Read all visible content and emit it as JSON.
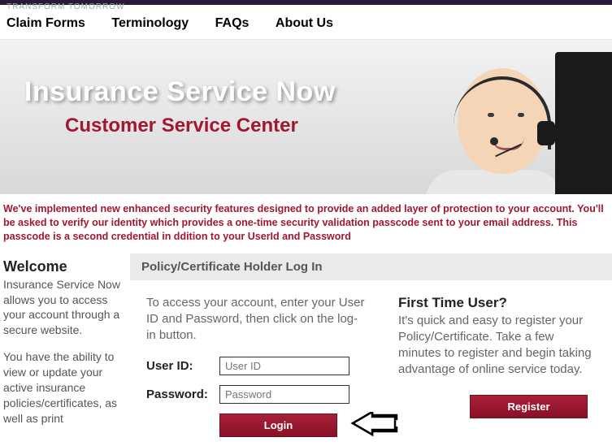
{
  "tagline": "TRANSFORM TOMORROW",
  "nav": {
    "claim_forms": "Claim Forms",
    "terminology": "Terminology",
    "faqs": "FAQs",
    "about_us": "About Us"
  },
  "hero": {
    "title": "Insurance Service Now",
    "subtitle": "Customer Service Center"
  },
  "notice": "We've implemented new enhanced security features designed to provide an added layer of protection to your account. You'll be asked to verify our identity which provides a one-time security validation passcode sent to your email address. This passcode is a second credential in ddition to your UserId and Password",
  "welcome": {
    "heading": "Welcome",
    "p1": "Insurance Service Now allows you to access your account through a secure website.",
    "p2": "You have the ability to view or update your active insurance policies/certificates, as well as print"
  },
  "login": {
    "header": "Policy/Certificate Holder Log In",
    "intro": "To access your account, enter your User ID and Password, then click on the log-in button.",
    "userid_label": "User ID:",
    "userid_placeholder": "User ID",
    "password_label": "Password:",
    "password_placeholder": "Password",
    "login_btn": "Login"
  },
  "first_time": {
    "heading": "First Time User?",
    "body": "It's quick and easy to register your Policy/Certificate. Take a few minutes to register and begin taking advantage of online service today.",
    "register_btn": "Register"
  }
}
